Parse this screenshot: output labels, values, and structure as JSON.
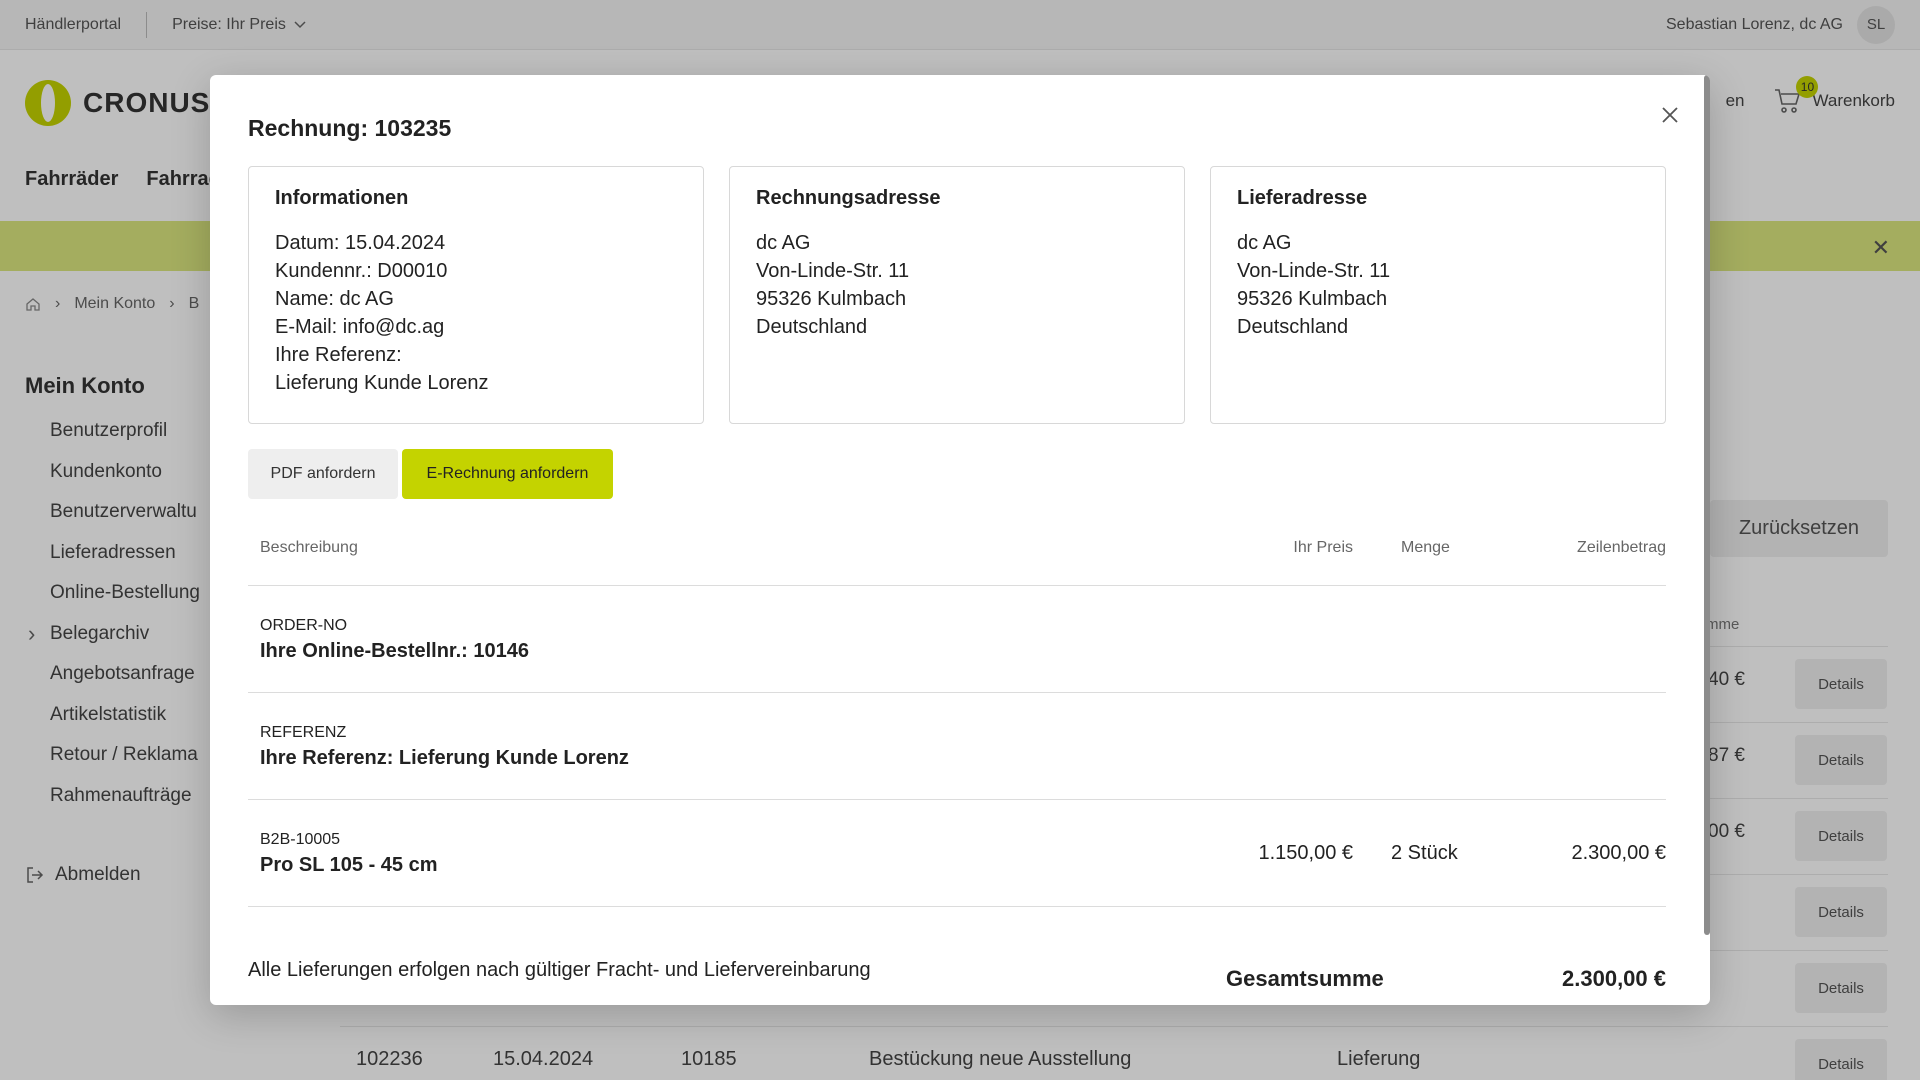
{
  "topbar": {
    "portal": "Händlerportal",
    "price_mode": "Preise: Ihr Preis",
    "user": "Sebastian Lorenz, dc AG",
    "avatar_initials": "SL"
  },
  "header": {
    "logo_text": "CRONUS E",
    "partial_link": "en",
    "cart_count": "10",
    "cart_label": "Warenkorb"
  },
  "nav": [
    "Fahrräder",
    "Fahrrad"
  ],
  "breadcrumb": [
    "Mein Konto",
    "B"
  ],
  "sidebar": {
    "title": "Mein Konto",
    "items": [
      "Benutzerprofil",
      "Kundenkonto",
      "Benutzerverwaltu",
      "Lieferadressen",
      "Online-Bestellung",
      "Belegarchiv",
      "Angebotsanfrage",
      "Artikelstatistik",
      "Retour / Reklama",
      "Rahmenaufträge"
    ],
    "logout": "Abmelden"
  },
  "background_table": {
    "reset": "Zurücksetzen",
    "col_head": "mme",
    "row_amounts": [
      "40 €",
      "87 €",
      "00 €",
      "",
      ""
    ],
    "details_label": "Details",
    "last_row": {
      "nr": "102236",
      "date": "15.04.2024",
      "order": "10185",
      "desc": "Bestückung neue Ausstellung",
      "type": "Lieferung"
    }
  },
  "modal": {
    "title": "Rechnung: 103235",
    "info": {
      "heading": "Informationen",
      "lines": [
        "Datum: 15.04.2024",
        "Kundennr.: D00010",
        "Name: dc AG",
        "E-Mail: info@dc.ag",
        "Ihre Referenz:",
        "Lieferung Kunde Lorenz"
      ]
    },
    "billing": {
      "heading": "Rechnungsadresse",
      "lines": [
        "dc AG",
        "Von-Linde-Str. 11",
        "95326 Kulmbach",
        "Deutschland"
      ]
    },
    "shipping": {
      "heading": "Lieferadresse",
      "lines": [
        "dc AG",
        "Von-Linde-Str. 11",
        "95326 Kulmbach",
        "Deutschland"
      ]
    },
    "buttons": {
      "pdf": "PDF anfordern",
      "erechnung": "E-Rechnung anfordern"
    },
    "table": {
      "headers": {
        "desc": "Beschreibung",
        "price": "Ihr Preis",
        "qty": "Menge",
        "total": "Zeilenbetrag"
      },
      "rows": [
        {
          "code": "ORDER-NO",
          "desc": "Ihre Online-Bestellnr.: 10146",
          "price": "",
          "qty": "",
          "total": ""
        },
        {
          "code": "REFERENZ",
          "desc": "Ihre Referenz: Lieferung Kunde Lorenz",
          "price": "",
          "qty": "",
          "total": ""
        },
        {
          "code": "B2B-10005",
          "desc": "Pro SL 105 - 45 cm",
          "price": "1.150,00 €",
          "qty": "2 Stück",
          "total": "2.300,00 €"
        }
      ]
    },
    "footer_note": "Alle Lieferungen erfolgen nach gültiger Fracht- und Liefervereinbarung",
    "total_label": "Gesamtsumme",
    "total_value": "2.300,00 €"
  },
  "colors": {
    "accent": "#c4d300",
    "promo": "#dbe77f"
  }
}
